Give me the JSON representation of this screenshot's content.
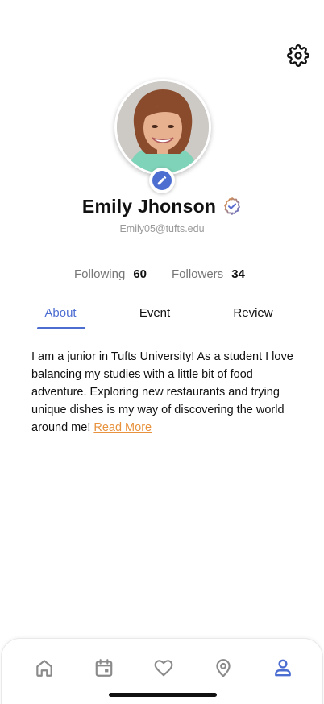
{
  "header": {
    "settings_icon": "gear-icon"
  },
  "profile": {
    "avatar_alt": "profile photo",
    "edit_icon": "pencil-icon",
    "name": "Emily Jhonson",
    "verified_icon": "verified-badge-icon",
    "verified_color": "#e8923d",
    "email": "Emily05@tufts.edu"
  },
  "stats": {
    "following_label": "Following",
    "following_count": "60",
    "followers_label": "Followers",
    "followers_count": "34"
  },
  "tabs": [
    {
      "label": "About",
      "active": true
    },
    {
      "label": "Event",
      "active": false
    },
    {
      "label": "Review",
      "active": false
    }
  ],
  "bio": {
    "text": "I am a junior in Tufts University! As a student I love balancing my studies with a little bit of food adventure. Exploring new restaurants and trying unique dishes is my way of discovering the world around me!",
    "read_more": "Read More"
  },
  "bottom_nav": [
    {
      "icon": "home-icon",
      "active": false
    },
    {
      "icon": "calendar-icon",
      "active": false
    },
    {
      "icon": "heart-icon",
      "active": false
    },
    {
      "icon": "location-pin-icon",
      "active": false
    },
    {
      "icon": "user-icon",
      "active": true
    }
  ],
  "colors": {
    "accent": "#4d6ed1",
    "link": "#e8923d",
    "inactive_icon": "#8a8a8a",
    "text": "#111111"
  }
}
